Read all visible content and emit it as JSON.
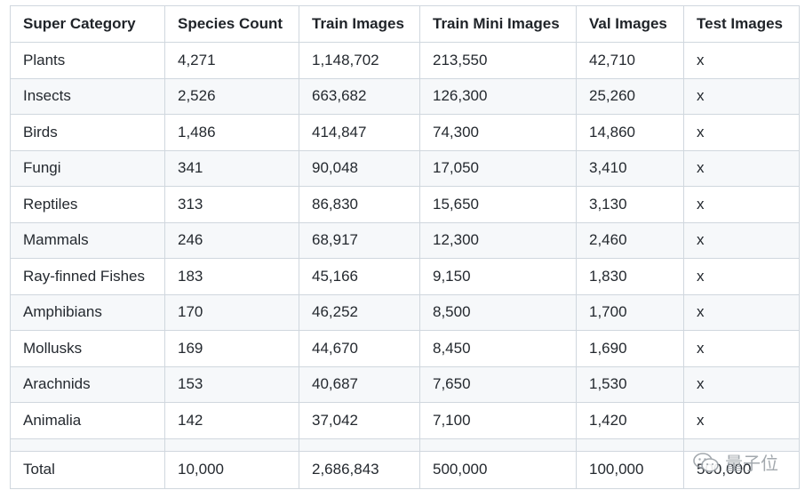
{
  "table": {
    "headers": [
      "Super Category",
      "Species Count",
      "Train Images",
      "Train Mini Images",
      "Val Images",
      "Test Images"
    ],
    "rows": [
      [
        "Plants",
        "4,271",
        "1,148,702",
        "213,550",
        "42,710",
        "x"
      ],
      [
        "Insects",
        "2,526",
        "663,682",
        "126,300",
        "25,260",
        "x"
      ],
      [
        "Birds",
        "1,486",
        "414,847",
        "74,300",
        "14,860",
        "x"
      ],
      [
        "Fungi",
        "341",
        "90,048",
        "17,050",
        "3,410",
        "x"
      ],
      [
        "Reptiles",
        "313",
        "86,830",
        "15,650",
        "3,130",
        "x"
      ],
      [
        "Mammals",
        "246",
        "68,917",
        "12,300",
        "2,460",
        "x"
      ],
      [
        "Ray-finned Fishes",
        "183",
        "45,166",
        "9,150",
        "1,830",
        "x"
      ],
      [
        "Amphibians",
        "170",
        "46,252",
        "8,500",
        "1,700",
        "x"
      ],
      [
        "Mollusks",
        "169",
        "44,670",
        "8,450",
        "1,690",
        "x"
      ],
      [
        "Arachnids",
        "153",
        "40,687",
        "7,650",
        "1,530",
        "x"
      ],
      [
        "Animalia",
        "142",
        "37,042",
        "7,100",
        "1,420",
        "x"
      ]
    ],
    "total": [
      "Total",
      "10,000",
      "2,686,843",
      "500,000",
      "100,000",
      "500,000"
    ]
  },
  "watermark": {
    "text": "量子位",
    "icon": "wechat-icon"
  },
  "colors": {
    "border": "#d0d7de",
    "stripe": "#f6f8fa",
    "text": "#24292f"
  }
}
